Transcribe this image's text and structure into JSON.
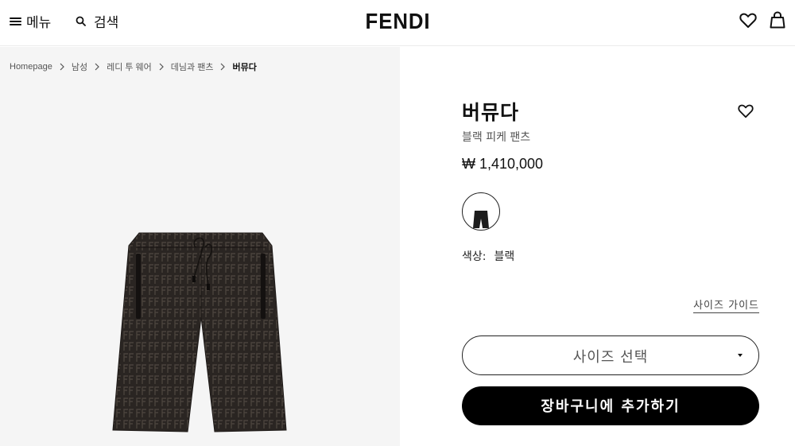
{
  "header": {
    "menu_label": "메뉴",
    "search_label": "검색",
    "logo": "FENDI",
    "icons": [
      "hamburger-icon",
      "search-icon",
      "heart-icon",
      "shopping-bag-icon"
    ]
  },
  "breadcrumb": {
    "items": [
      "Homepage",
      "남성",
      "레디 투 웨어",
      "데님과 팬츠",
      "버뮤다"
    ]
  },
  "product": {
    "title": "버뮤다",
    "subtitle": "블랙 피케 팬츠",
    "price": "₩ 1,410,000",
    "color_label": "색상:",
    "color_value": "블랙",
    "swatch_color": "#1c1c1c"
  },
  "size": {
    "guide_label": "사이즈 가이드",
    "select_label": "사이즈 선택"
  },
  "cart": {
    "add_label": "장바구니에 추가하기"
  },
  "colors": {
    "accent": "#000000",
    "image_background": "#f5f5f5",
    "fabric_dark": "#2a2522",
    "fabric_pattern": "#4a423c"
  }
}
